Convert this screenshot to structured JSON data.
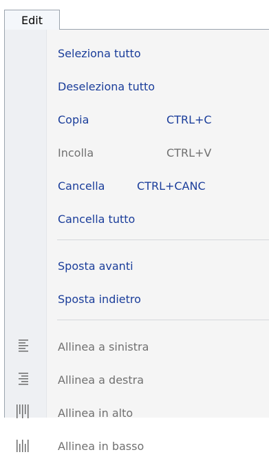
{
  "menu_bar": {
    "edit_label": "Edit"
  },
  "menu": {
    "items": [
      {
        "label": "Seleziona tutto",
        "shortcut": "",
        "enabled": true
      },
      {
        "label": "Deseleziona tutto",
        "shortcut": "",
        "enabled": true
      },
      {
        "label": "Copia",
        "shortcut": "CTRL+C",
        "enabled": true
      },
      {
        "label": "Incolla",
        "shortcut": "CTRL+V",
        "enabled": false
      },
      {
        "label": "Cancella",
        "shortcut": "CTRL+CANC",
        "enabled": true
      },
      {
        "label": "Cancella tutto",
        "shortcut": "",
        "enabled": true
      },
      {
        "label": "Sposta avanti",
        "shortcut": "",
        "enabled": true
      },
      {
        "label": "Sposta indietro",
        "shortcut": "",
        "enabled": true
      },
      {
        "label": "Allinea a sinistra",
        "shortcut": "",
        "enabled": false,
        "icon": "align-left-icon"
      },
      {
        "label": "Allinea a destra",
        "shortcut": "",
        "enabled": false,
        "icon": "align-right-icon"
      },
      {
        "label": "Allinea in alto",
        "shortcut": "",
        "enabled": false,
        "icon": "align-top-icon"
      },
      {
        "label": "Allinea in basso",
        "shortcut": "",
        "enabled": false,
        "icon": "align-bottom-icon"
      }
    ]
  },
  "colors": {
    "enabled_text": "#1a3d9a",
    "disabled_text": "#707070",
    "menu_background": "#f5f5f5",
    "gutter_background": "#eef0f3",
    "separator": "#d4d7db"
  }
}
